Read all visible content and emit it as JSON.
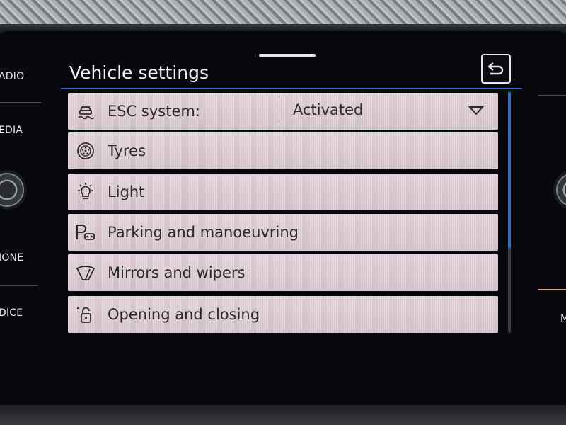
{
  "side_left": {
    "items": [
      "ADIO",
      "EDIA",
      "IONE",
      "DICE"
    ]
  },
  "side_right": {
    "label": "M"
  },
  "header": {
    "title": "Vehicle settings"
  },
  "menu": {
    "items": [
      {
        "label": "ESC system:",
        "icon": "esc-icon",
        "value": "Activated"
      },
      {
        "label": "Tyres",
        "icon": "tyre-icon"
      },
      {
        "label": "Light",
        "icon": "light-icon"
      },
      {
        "label": "Parking and manoeuvring",
        "icon": "parking-icon"
      },
      {
        "label": "Mirrors and wipers",
        "icon": "wiper-icon"
      },
      {
        "label": "Opening and closing",
        "icon": "lock-icon"
      }
    ]
  },
  "colors": {
    "accent": "#2f6fc9",
    "row_bg": "#e3d3da",
    "text_dark": "#2b2a2e",
    "text_light": "#f2f2f4"
  }
}
